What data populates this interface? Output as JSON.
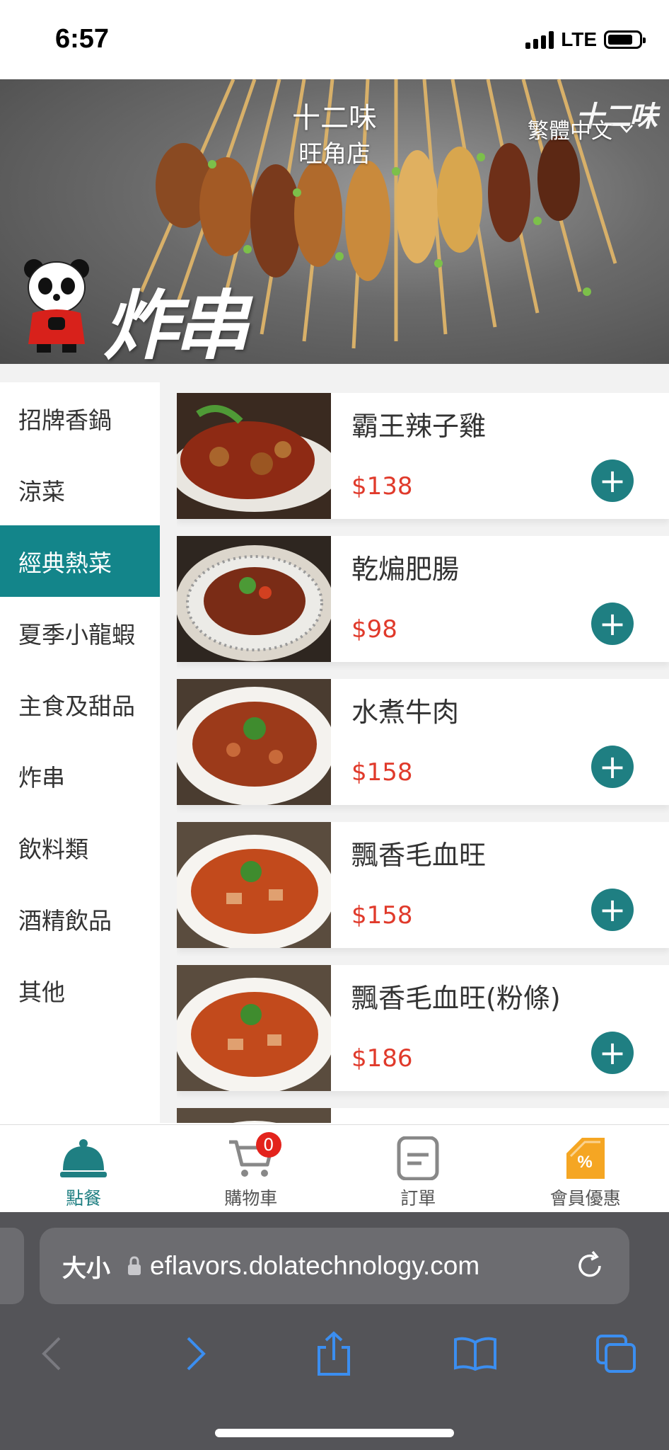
{
  "status": {
    "time": "6:57",
    "network": "LTE"
  },
  "hero": {
    "store_name": "十二味",
    "branch": "旺角店",
    "language": "繁體中文",
    "brand_logo": "十二味",
    "banner_title": "炸串"
  },
  "sidebar": {
    "items": [
      {
        "label": "招牌香鍋"
      },
      {
        "label": "涼菜"
      },
      {
        "label": "經典熱菜",
        "active": true
      },
      {
        "label": "夏季小龍蝦"
      },
      {
        "label": "主食及甜品"
      },
      {
        "label": "炸串"
      },
      {
        "label": "飲料類"
      },
      {
        "label": "酒精飲品"
      },
      {
        "label": "其他"
      }
    ]
  },
  "menu": {
    "items": [
      {
        "name": "霸王辣子雞",
        "price": "$138"
      },
      {
        "name": "乾煸肥腸",
        "price": "$98"
      },
      {
        "name": "水煮牛肉",
        "price": "$158"
      },
      {
        "name": "飄香毛血旺",
        "price": "$158"
      },
      {
        "name": "飄香毛血旺(粉條)",
        "price": "$186"
      }
    ]
  },
  "tabbar": {
    "tabs": [
      {
        "label": "點餐",
        "icon": "cloche-icon"
      },
      {
        "label": "購物車",
        "icon": "cart-icon",
        "badge": "0"
      },
      {
        "label": "訂單",
        "icon": "order-icon"
      },
      {
        "label": "會員優惠",
        "icon": "coupon-icon"
      }
    ]
  },
  "browser": {
    "text_size": "大小",
    "url": "eflavors.dolatechnology.com"
  },
  "colors": {
    "accent": "#13858a",
    "price": "#e03a2b",
    "badge": "#e3231c",
    "coupon": "#f5a623"
  }
}
